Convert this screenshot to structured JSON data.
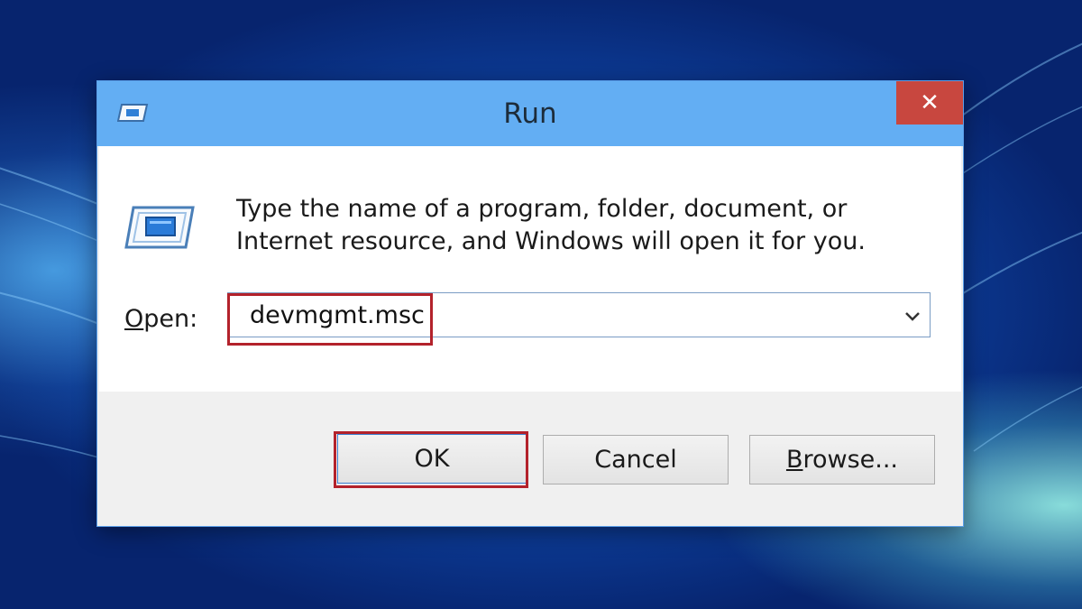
{
  "window": {
    "title": "Run",
    "close_glyph": "✕"
  },
  "body": {
    "description": "Type the name of a program, folder, document, or Internet resource, and Windows will open it for you."
  },
  "open_field": {
    "label_mnemonic": "O",
    "label_rest": "pen:",
    "value": "devmgmt.msc"
  },
  "buttons": {
    "ok": "OK",
    "cancel": "Cancel",
    "browse_mnemonic": "B",
    "browse_rest": "rowse..."
  },
  "colors": {
    "titlebar": "#63aef3",
    "close": "#c8473f",
    "highlight": "#b3222b"
  },
  "icons": [
    "run-app-icon",
    "run-large-icon",
    "close-icon",
    "dropdown-arrow-icon"
  ]
}
